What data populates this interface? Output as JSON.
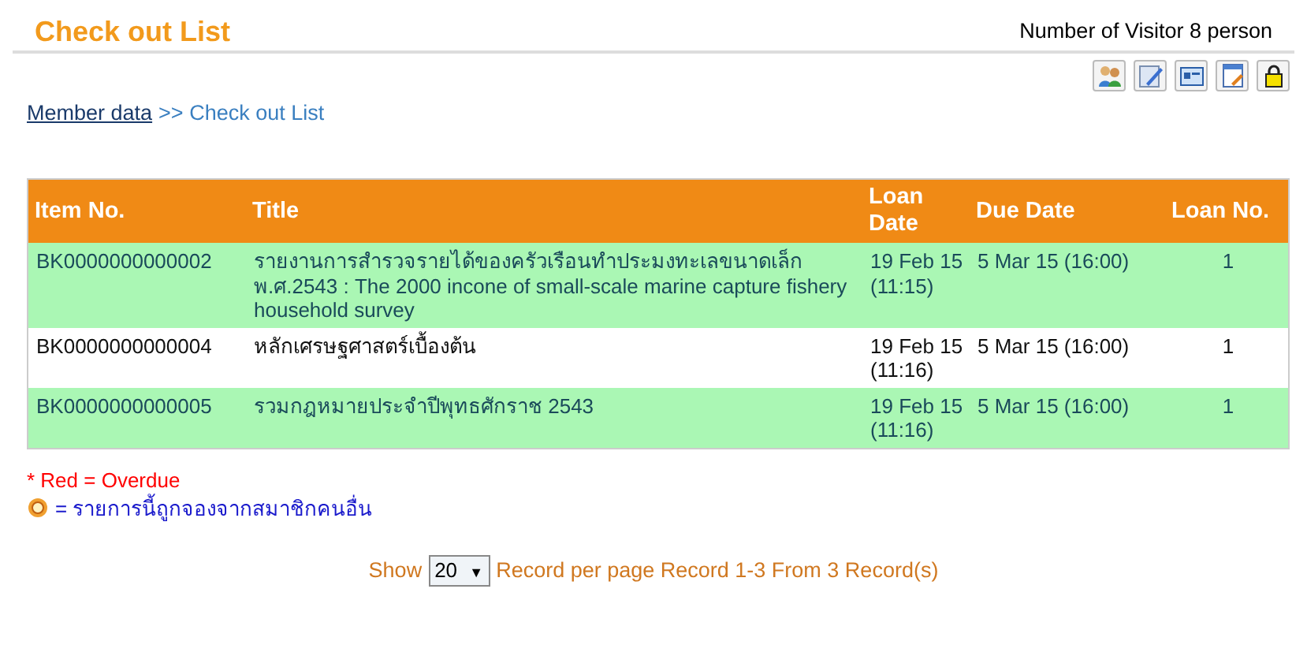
{
  "header": {
    "title": "Check out List",
    "visitor_count": "Number of Visitor 8 person"
  },
  "toolbar": {
    "buttons": [
      {
        "kind": "members"
      },
      {
        "kind": "edit"
      },
      {
        "kind": "card"
      },
      {
        "kind": "note"
      },
      {
        "kind": "lock"
      }
    ]
  },
  "breadcrumb": {
    "link": "Member data",
    "current": ">> Check out List"
  },
  "table": {
    "columns": [
      "Item No.",
      "Title",
      "Loan Date",
      "Due Date",
      "Loan No."
    ],
    "rows": [
      {
        "highlighted": true,
        "cells": [
          "BK0000000000002",
          "รายงานการสำรวจรายได้ของครัวเรือนทำประมงทะเลขนาดเล็กพ.ศ.2543 : The 2000 incone of small-scale marine capture fishery household survey",
          "19 Feb 15 (11:15)",
          "5 Mar 15 (16:00)",
          "1"
        ]
      },
      {
        "highlighted": false,
        "cells": [
          "BK0000000000004",
          "หลักเศรษฐศาสตร์เบื้องต้น",
          "19 Feb 15 (11:16)",
          "5 Mar 15 (16:00)",
          "1"
        ]
      },
      {
        "highlighted": true,
        "cells": [
          "BK0000000000005",
          "รวมกฎหมายประจำปีพุทธศักราช 2543",
          "19 Feb 15 (11:16)",
          "5 Mar 15 (16:00)",
          "1"
        ]
      }
    ]
  },
  "legend": {
    "overdue": "* Red = Overdue",
    "reserved": "= รายการนี้ถูกจองจากสมาชิกคนอื่น"
  },
  "pager": {
    "show": "Show",
    "per_page": "20",
    "caret": "▼",
    "summary": "Record per page Record 1-3 From 3 Record(s)"
  }
}
